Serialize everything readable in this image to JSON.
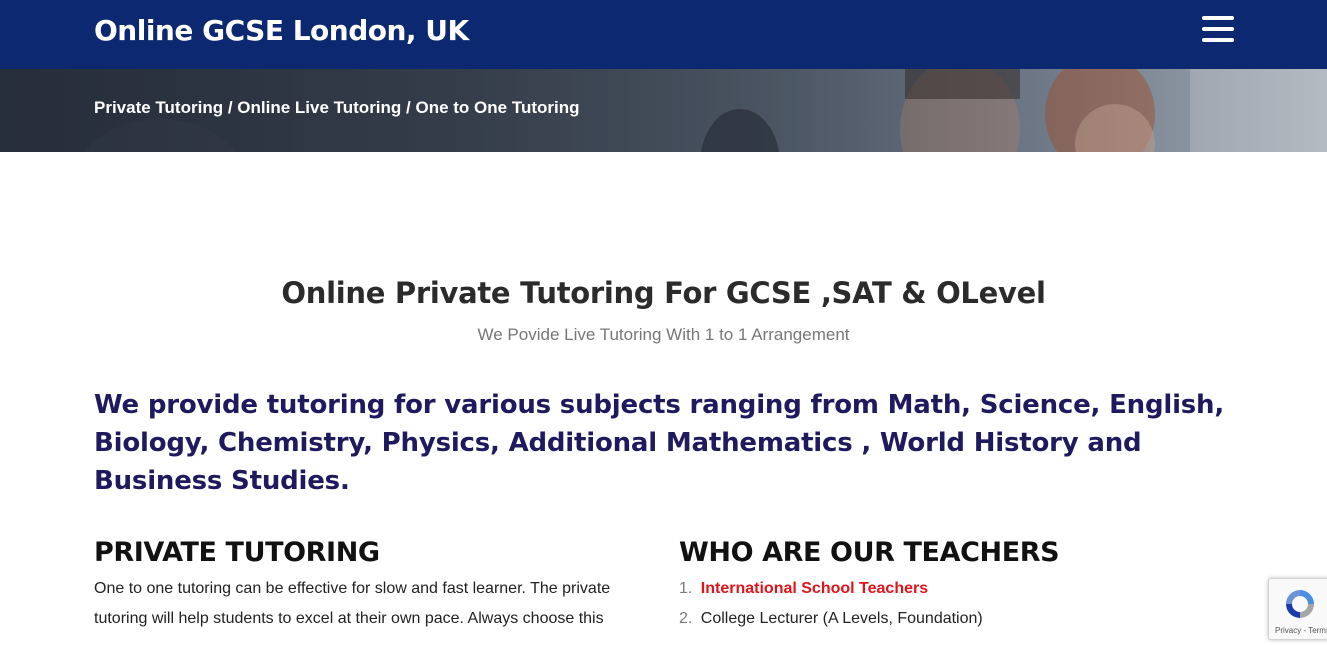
{
  "header": {
    "site_title": "Online GCSE London, UK",
    "menu_icon": "hamburger-menu-icon",
    "bg_color": "#0c2870"
  },
  "hero": {
    "breadcrumb": [
      "Private Tutoring",
      "Online Live Tutoring",
      "One to One Tutoring"
    ],
    "separator": "/"
  },
  "main": {
    "title": "Online Private Tutoring For GCSE ,SAT & OLevel",
    "subtitle": "We Povide Live Tutoring With 1 to 1 Arrangement",
    "intro": "We provide tutoring for various subjects ranging from Math, Science, English, Biology, Chemistry, Physics, Additional Mathematics , World History and Business Studies.",
    "intro_color": "#1f1a5e"
  },
  "private_tutoring": {
    "heading": "PRIVATE TUTORING",
    "text": "One to one tutoring can be effective for slow and fast learner.  The private tutoring will help students  to excel at their own pace. Always choose this"
  },
  "teachers": {
    "heading": "WHO ARE OUR TEACHERS",
    "items": [
      {
        "num": "1.",
        "label": "International School Teachers",
        "link": true
      },
      {
        "num": "2.",
        "label": "College Lecturer (A Levels, Foundation)",
        "link": false
      }
    ],
    "link_color": "#e0151b"
  },
  "recaptcha": {
    "icon": "recaptcha-logo-icon",
    "terms": "Privacy - Terms"
  }
}
